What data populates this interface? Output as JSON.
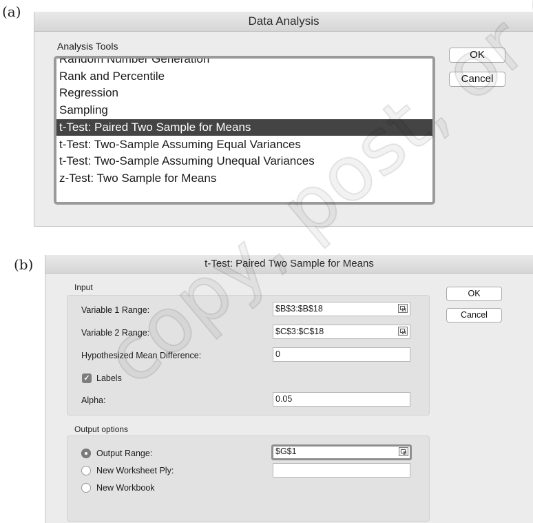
{
  "labels": {
    "a": "(a)",
    "b": "(b)"
  },
  "data_analysis": {
    "title": "Data Analysis",
    "tools_label": "Analysis Tools",
    "items": [
      "Random Number Generation",
      "Rank and Percentile",
      "Regression",
      "Sampling",
      "t-Test: Paired Two Sample for Means",
      "t-Test: Two-Sample Assuming Equal Variances",
      "t-Test: Two-Sample Assuming Unequal Variances",
      "z-Test: Two Sample for Means"
    ],
    "selected_item": "t-Test: Paired Two Sample for Means",
    "ok_label": "OK",
    "cancel_label": "Cancel"
  },
  "ttest_dialog": {
    "title": "t-Test: Paired Two Sample for Means",
    "input_section": "Input",
    "var1_label": "Variable 1 Range:",
    "var1_value": "$B$3:$B$18",
    "var2_label": "Variable 2 Range:",
    "var2_value": "$C$3:$C$18",
    "hyp_label": "Hypothesized Mean Difference:",
    "hyp_value": "0",
    "labels_checkbox": "Labels",
    "labels_checked": true,
    "alpha_label": "Alpha:",
    "alpha_value": "0.05",
    "output_section": "Output options",
    "output_range_label": "Output Range:",
    "output_range_value": "$G$1",
    "new_ply_label": "New Worksheet Ply:",
    "new_ply_value": "",
    "new_workbook_label": "New Workbook",
    "selected_output": "Output Range",
    "ok_label": "OK",
    "cancel_label": "Cancel"
  },
  "watermark": "copy, post, or distribute",
  "colors": {
    "selection": "#444444",
    "dialog_bg": "#ececec",
    "group_bg": "#e2e2e2"
  }
}
